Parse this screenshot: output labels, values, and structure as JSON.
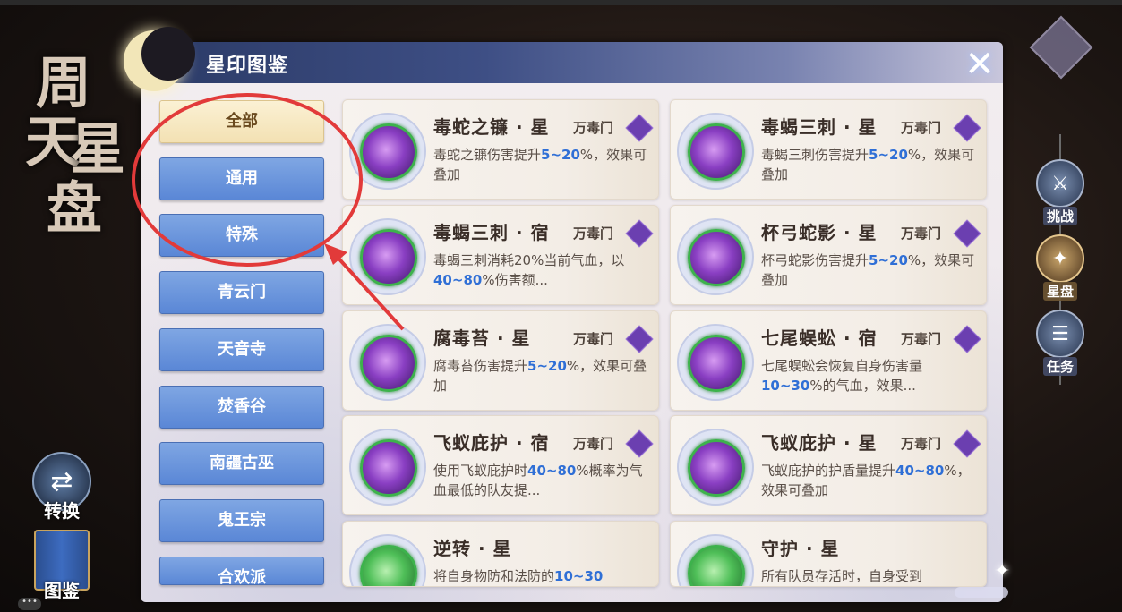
{
  "game": {
    "calligraphy_title": [
      "周",
      "天",
      "星",
      "盘"
    ],
    "left_buttons": [
      {
        "label": "转换",
        "icon": "swap-icon"
      },
      {
        "label": "图鉴",
        "icon": "book-icon"
      }
    ],
    "chat_dots": "•••",
    "right_nav": [
      {
        "label": "挑战",
        "icon": "challenge-icon"
      },
      {
        "label": "星盘",
        "icon": "star-disc-icon",
        "active": true
      },
      {
        "label": "任务",
        "icon": "task-icon"
      }
    ]
  },
  "panel": {
    "title": "星印图鉴",
    "close_glyph": "✕",
    "categories": [
      {
        "label": "全部",
        "selected": true
      },
      {
        "label": "通用"
      },
      {
        "label": "特殊"
      },
      {
        "label": "青云门"
      },
      {
        "label": "天音寺"
      },
      {
        "label": "焚香谷"
      },
      {
        "label": "南疆古巫"
      },
      {
        "label": "鬼王宗"
      },
      {
        "label": "合欢派"
      }
    ],
    "cards": [
      {
        "name": "毒蛇之镰 · 星",
        "sect": "万毒门",
        "desc_pre": "毒蛇之镰伤害提升",
        "desc_hl": "5~20",
        "desc_post": "%，效果可叠加",
        "orb": "purple"
      },
      {
        "name": "毒蝎三刺 · 星",
        "sect": "万毒门",
        "desc_pre": "毒蝎三刺伤害提升",
        "desc_hl": "5~20",
        "desc_post": "%，效果可叠加",
        "orb": "purple"
      },
      {
        "name": "毒蝎三刺 · 宿",
        "sect": "万毒门",
        "desc_pre": "毒蝎三刺消耗20%当前气血，以",
        "desc_hl": "40~80",
        "desc_post": "%伤害额...",
        "orb": "purple"
      },
      {
        "name": "杯弓蛇影 · 星",
        "sect": "万毒门",
        "desc_pre": "杯弓蛇影伤害提升",
        "desc_hl": "5~20",
        "desc_post": "%，效果可叠加",
        "orb": "purple"
      },
      {
        "name": "腐毒苔 · 星",
        "sect": "万毒门",
        "desc_pre": "腐毒苔伤害提升",
        "desc_hl": "5~20",
        "desc_post": "%，效果可叠加",
        "orb": "purple"
      },
      {
        "name": "七尾蜈蚣 · 宿",
        "sect": "万毒门",
        "desc_pre": "七尾蜈蚣会恢复自身伤害量",
        "desc_hl": "10~30",
        "desc_post": "%的气血，效果...",
        "orb": "purple"
      },
      {
        "name": "飞蚁庇护 · 宿",
        "sect": "万毒门",
        "desc_pre": "使用飞蚁庇护时",
        "desc_hl": "40~80",
        "desc_post": "%概率为气血最低的队友提...",
        "orb": "purple"
      },
      {
        "name": "飞蚁庇护 · 星",
        "sect": "万毒门",
        "desc_pre": "飞蚁庇护的护盾量提升",
        "desc_hl": "40~80",
        "desc_post": "%，效果可叠加",
        "orb": "purple"
      },
      {
        "name": "逆转 · 星",
        "sect": "",
        "desc_pre": "将自身物防和法防的",
        "desc_hl": "10~30",
        "desc_post": "",
        "orb": "green"
      },
      {
        "name": "守护 · 星",
        "sect": "",
        "desc_pre": "所有队员存活时，自身受到",
        "desc_hl": "",
        "desc_post": "",
        "orb": "green"
      }
    ]
  }
}
